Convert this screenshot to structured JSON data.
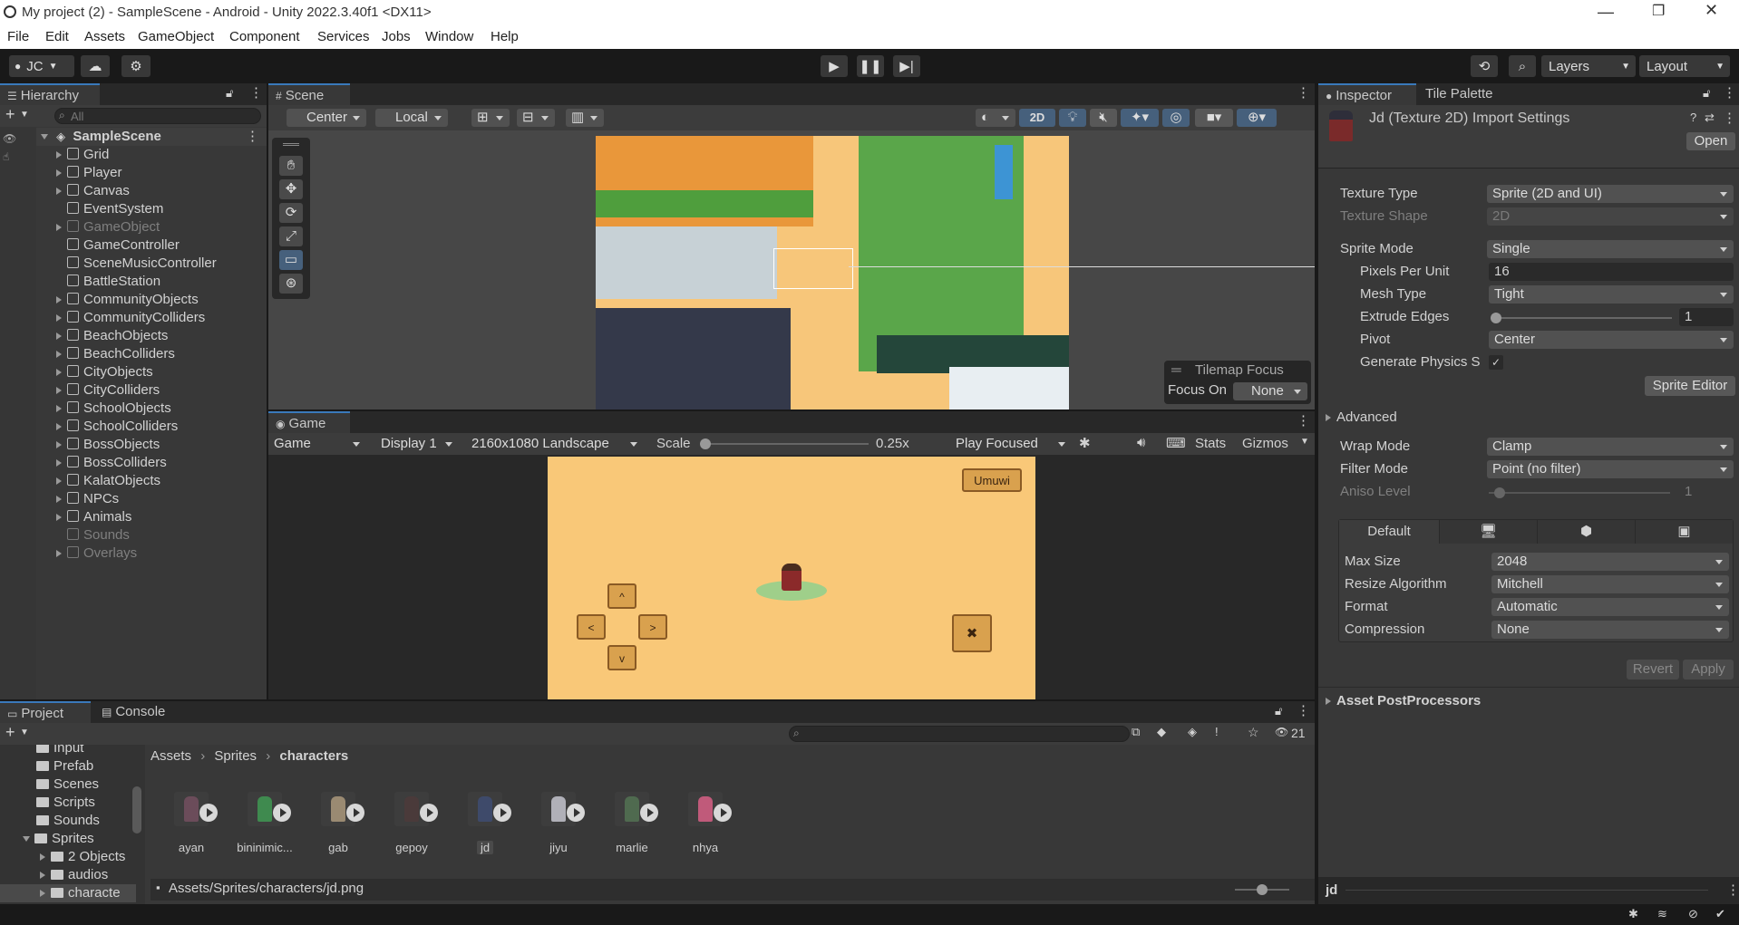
{
  "window": {
    "title": "My project (2) - SampleScene - Android - Unity 2022.3.40f1 <DX11>"
  },
  "menu": [
    "File",
    "Edit",
    "Assets",
    "GameObject",
    "Component",
    "Services",
    "Jobs",
    "Window",
    "Help"
  ],
  "toolbar": {
    "account": "JC",
    "layers": "Layers",
    "layout": "Layout"
  },
  "hierarchy": {
    "tab": "Hierarchy",
    "search_placeholder": "All",
    "scene": "SampleScene",
    "items": [
      {
        "label": "Grid",
        "expandable": true,
        "disabled": false
      },
      {
        "label": "Player",
        "expandable": true,
        "disabled": false
      },
      {
        "label": "Canvas",
        "expandable": true,
        "disabled": false
      },
      {
        "label": "EventSystem",
        "expandable": false,
        "disabled": false
      },
      {
        "label": "GameObject",
        "expandable": true,
        "disabled": true
      },
      {
        "label": "GameController",
        "expandable": false,
        "disabled": false
      },
      {
        "label": "SceneMusicController",
        "expandable": false,
        "disabled": false
      },
      {
        "label": "BattleStation",
        "expandable": false,
        "disabled": false
      },
      {
        "label": "CommunityObjects",
        "expandable": true,
        "disabled": false
      },
      {
        "label": "CommunityColliders",
        "expandable": true,
        "disabled": false
      },
      {
        "label": "BeachObjects",
        "expandable": true,
        "disabled": false
      },
      {
        "label": "BeachColliders",
        "expandable": true,
        "disabled": false
      },
      {
        "label": "CityObjects",
        "expandable": true,
        "disabled": false
      },
      {
        "label": "CityColliders",
        "expandable": true,
        "disabled": false
      },
      {
        "label": "SchoolObjects",
        "expandable": true,
        "disabled": false
      },
      {
        "label": "SchoolColliders",
        "expandable": true,
        "disabled": false
      },
      {
        "label": "BossObjects",
        "expandable": true,
        "disabled": false
      },
      {
        "label": "BossColliders",
        "expandable": true,
        "disabled": false
      },
      {
        "label": "KalatObjects",
        "expandable": true,
        "disabled": false
      },
      {
        "label": "NPCs",
        "expandable": true,
        "disabled": false
      },
      {
        "label": "Animals",
        "expandable": true,
        "disabled": false
      },
      {
        "label": "Sounds",
        "expandable": false,
        "disabled": true
      },
      {
        "label": "Overlays",
        "expandable": true,
        "disabled": true
      }
    ]
  },
  "scene": {
    "tab": "Scene",
    "pivot": "Center",
    "space": "Local",
    "mode_2d": "2D",
    "tilemap_focus": {
      "title": "Tilemap Focus",
      "label": "Focus On",
      "value": "None"
    }
  },
  "game": {
    "tab": "Game",
    "view": "Game",
    "display": "Display 1",
    "resolution": "2160x1080 Landscape",
    "scale_label": "Scale",
    "scale_value": "0.25x",
    "play_mode": "Play Focused",
    "stats": "Stats",
    "gizmos": "Gizmos",
    "button_label": "Umuwi"
  },
  "inspector": {
    "tab": "Inspector",
    "tab2": "Tile Palette",
    "title": "Jd (Texture 2D) Import Settings",
    "open": "Open",
    "fields": {
      "texture_type": {
        "label": "Texture Type",
        "value": "Sprite (2D and UI)"
      },
      "texture_shape": {
        "label": "Texture Shape",
        "value": "2D"
      },
      "sprite_mode": {
        "label": "Sprite Mode",
        "value": "Single"
      },
      "ppu": {
        "label": "Pixels Per Unit",
        "value": "16"
      },
      "mesh_type": {
        "label": "Mesh Type",
        "value": "Tight"
      },
      "extrude": {
        "label": "Extrude Edges",
        "value": "1"
      },
      "pivot": {
        "label": "Pivot",
        "value": "Center"
      },
      "gen_physics": {
        "label": "Generate Physics S",
        "value": "✓"
      }
    },
    "sprite_editor": "Sprite Editor",
    "advanced": "Advanced",
    "wrap_mode": {
      "label": "Wrap Mode",
      "value": "Clamp"
    },
    "filter_mode": {
      "label": "Filter Mode",
      "value": "Point (no filter)"
    },
    "aniso": {
      "label": "Aniso Level",
      "value": "1"
    },
    "platform_tab": "Default",
    "max_size": {
      "label": "Max Size",
      "value": "2048"
    },
    "resize": {
      "label": "Resize Algorithm",
      "value": "Mitchell"
    },
    "format": {
      "label": "Format",
      "value": "Automatic"
    },
    "compression": {
      "label": "Compression",
      "value": "None"
    },
    "revert": "Revert",
    "apply": "Apply",
    "postprocessors": "Asset PostProcessors",
    "footer_name": "jd"
  },
  "project": {
    "tab": "Project",
    "tab2": "Console",
    "count": "21",
    "breadcrumb": [
      "Assets",
      "Sprites",
      "characters"
    ],
    "folders": [
      {
        "label": "Input",
        "indent": 1
      },
      {
        "label": "Prefab",
        "indent": 1
      },
      {
        "label": "Scenes",
        "indent": 1
      },
      {
        "label": "Scripts",
        "indent": 1
      },
      {
        "label": "Sounds",
        "indent": 1
      },
      {
        "label": "Sprites",
        "indent": 0
      },
      {
        "label": "2 Objects",
        "indent": 2
      },
      {
        "label": "audios",
        "indent": 2
      },
      {
        "label": "characte",
        "indent": 2
      }
    ],
    "assets": [
      "ayan",
      "bininimic...",
      "gab",
      "gepoy",
      "jd",
      "jiyu",
      "marlie",
      "nhya"
    ],
    "selected_asset": "jd",
    "path": "Assets/Sprites/characters/jd.png"
  },
  "colors": {
    "accent": "#3a79bb",
    "panel": "#383838",
    "dark": "#282828",
    "sand": "#f9c878"
  }
}
